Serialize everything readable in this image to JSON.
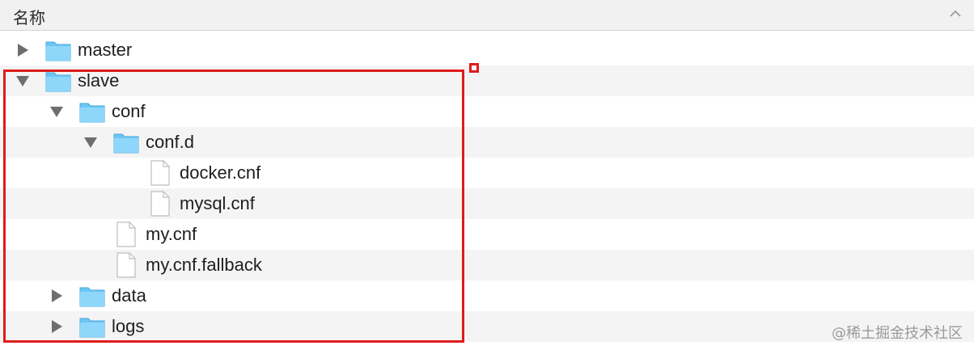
{
  "header": {
    "column_title": "名称",
    "sort_icon": "chevron-up-icon"
  },
  "tree": {
    "items": [
      {
        "label": "master",
        "type": "folder",
        "expanded": false,
        "depth": 0
      },
      {
        "label": "slave",
        "type": "folder",
        "expanded": true,
        "depth": 0
      },
      {
        "label": "conf",
        "type": "folder",
        "expanded": true,
        "depth": 1
      },
      {
        "label": "conf.d",
        "type": "folder",
        "expanded": true,
        "depth": 2
      },
      {
        "label": "docker.cnf",
        "type": "file",
        "depth": 3
      },
      {
        "label": "mysql.cnf",
        "type": "file",
        "depth": 3
      },
      {
        "label": "my.cnf",
        "type": "file",
        "depth": 2
      },
      {
        "label": "my.cnf.fallback",
        "type": "file",
        "depth": 2
      },
      {
        "label": "data",
        "type": "folder",
        "expanded": false,
        "depth": 1
      },
      {
        "label": "logs",
        "type": "folder",
        "expanded": false,
        "depth": 1
      }
    ]
  },
  "watermark": {
    "text": "@稀土掘金技术社区"
  },
  "colors": {
    "folder_blue": "#6cc6f5",
    "highlight_red": "#e01b1b",
    "row_alt": "#f4f4f4"
  }
}
